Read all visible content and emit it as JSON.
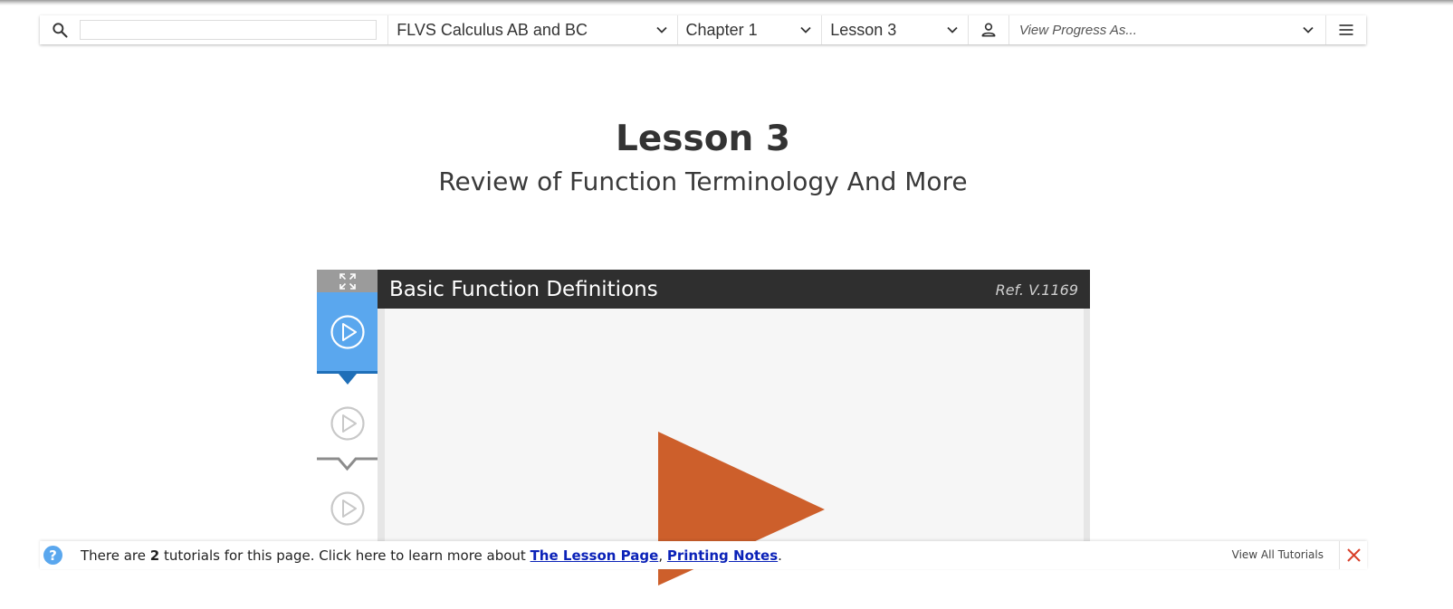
{
  "nav": {
    "search_placeholder": "",
    "course": "FLVS Calculus AB and BC",
    "chapter": "Chapter 1",
    "lesson": "Lesson 3",
    "view_progress": "View Progress As..."
  },
  "page": {
    "title": "Lesson 3",
    "subtitle": "Review of Function Terminology And More"
  },
  "video": {
    "title": "Basic Function Definitions",
    "ref": "Ref. V.1169"
  },
  "tutorial": {
    "text_before": "There are ",
    "count": "2",
    "text_after": " tutorials for this page. Click here to learn more about ",
    "link1": "The Lesson Page",
    "comma": ", ",
    "link2": "Printing Notes",
    "period": ".",
    "view_all": "View All Tutorials",
    "help_glyph": "?"
  },
  "colors": {
    "accent_blue": "#5aa7ee",
    "accent_blue_dark": "#1f6fb8",
    "play_orange": "#cd5f2b",
    "header_dark": "#2f2f2f",
    "close_red": "#d9402a",
    "link_blue": "#0b22b8"
  },
  "icons": [
    "search-icon",
    "chevron-down-icon",
    "user-icon",
    "menu-icon",
    "expand-icon",
    "play-circle-icon",
    "play-icon",
    "help-icon",
    "close-icon"
  ]
}
